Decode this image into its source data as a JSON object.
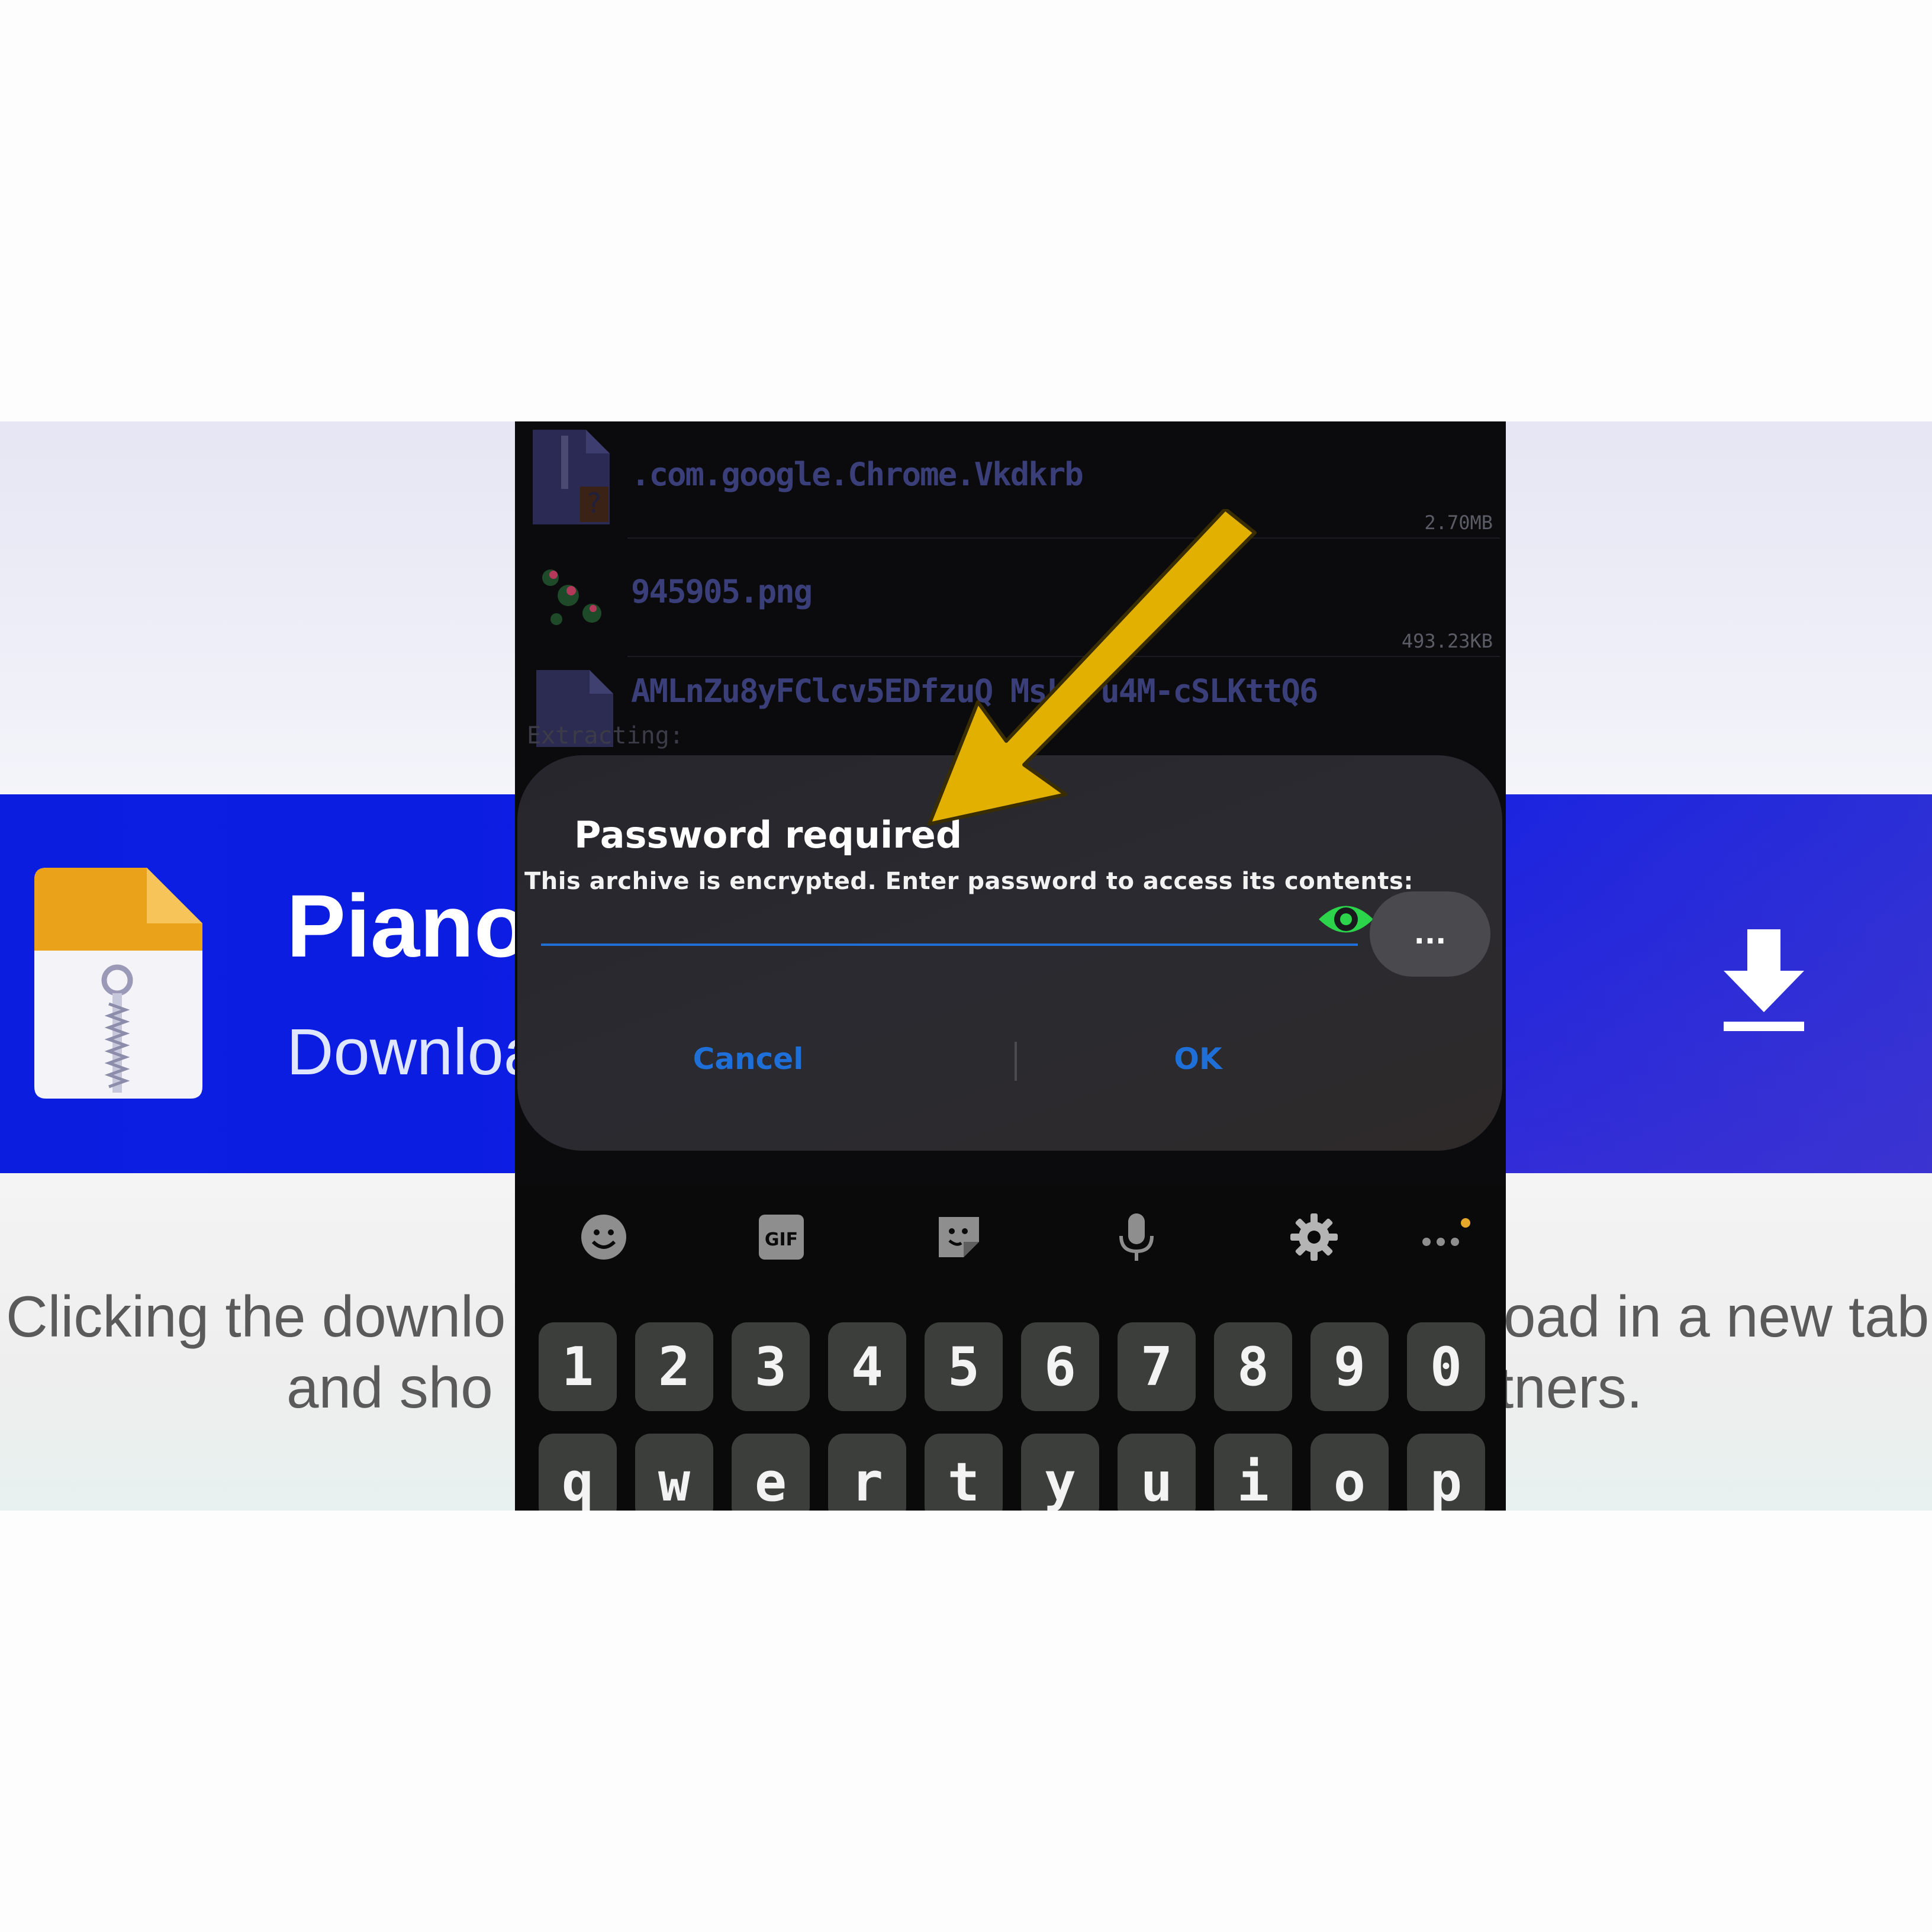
{
  "background": {
    "banner_title": "Piano",
    "banner_subtitle": "Downloa",
    "left_text_line1": "Clicking the downlo",
    "left_text_line2": "and sho",
    "right_text_line1": "oad in a new tab",
    "right_text_line2": "tners.",
    "icons": [
      "zip-file-icon",
      "download-arrow-icon"
    ],
    "colors": {
      "banner": "#0f1be6"
    }
  },
  "file_list": [
    {
      "name": ".com.google.Chrome.Vkdkrb",
      "size": "2.70MB",
      "icon": "unknown-archive-icon"
    },
    {
      "name": "945905.png",
      "size": "493.23KB",
      "icon": "image-thumbnail"
    },
    {
      "name": "AMLnZu8yFClcv5EDfzuQ      MsLEFu4M-cSLKttQ6",
      "size": "",
      "icon": "file-icon"
    }
  ],
  "status_text": "Extracting:",
  "dialog": {
    "title": "Password required",
    "message": "This archive is encrypted. Enter password to access its contents:",
    "input_value": "",
    "input_placeholder": "",
    "more_label": "...",
    "cancel_label": "Cancel",
    "ok_label": "OK",
    "colors": {
      "accent": "#1f6fd8",
      "eye": "#2bd44a"
    }
  },
  "keyboard": {
    "toolbar": [
      "emoji-icon",
      "gif-icon",
      "sticker-icon",
      "microphone-icon",
      "settings-gear-icon",
      "more-options-icon"
    ],
    "gif_label": "GIF",
    "number_row": [
      "1",
      "2",
      "3",
      "4",
      "5",
      "6",
      "7",
      "8",
      "9",
      "0"
    ],
    "letter_row": [
      "q",
      "w",
      "e",
      "r",
      "t",
      "y",
      "u",
      "i",
      "o",
      "p"
    ]
  },
  "annotation": {
    "icon": "yellow-arrow-icon",
    "color": "#e2b000"
  }
}
